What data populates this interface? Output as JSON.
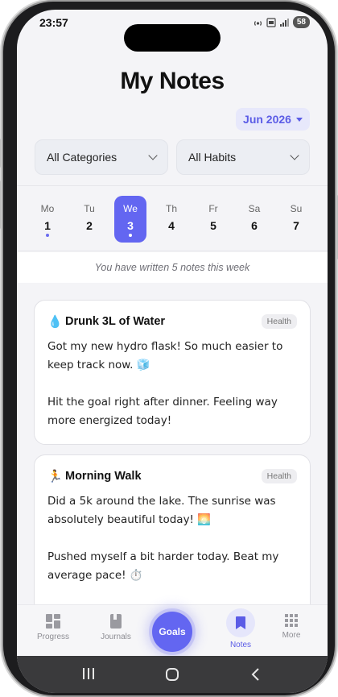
{
  "status_bar": {
    "time": "23:57",
    "battery": "58"
  },
  "header": {
    "title": "My Notes",
    "month": "Jun 2026"
  },
  "filters": {
    "category": "All Categories",
    "habit": "All Habits"
  },
  "week": {
    "days": [
      {
        "name": "Mo",
        "num": "1",
        "has_note": true
      },
      {
        "name": "Tu",
        "num": "2",
        "has_note": false
      },
      {
        "name": "We",
        "num": "3",
        "has_note": true,
        "selected": true
      },
      {
        "name": "Th",
        "num": "4",
        "has_note": false
      },
      {
        "name": "Fr",
        "num": "5",
        "has_note": false
      },
      {
        "name": "Sa",
        "num": "6",
        "has_note": false
      },
      {
        "name": "Su",
        "num": "7",
        "has_note": false
      }
    ],
    "summary": "You have written 5 notes this week"
  },
  "notes": [
    {
      "emoji": "💧",
      "title": "Drunk 3L of Water",
      "tag": "Health",
      "paragraphs": [
        "Got my new hydro flask! So much easier to keep track now. 🧊",
        "Hit the goal right after dinner. Feeling way more energized today!"
      ]
    },
    {
      "emoji": "🏃",
      "title": "Morning Walk",
      "tag": "Health",
      "paragraphs": [
        "Did a 5k around the lake. The sunrise was absolutely beautiful today! 🌅",
        "Pushed myself a bit harder today. Beat my average pace! ⏱️"
      ]
    }
  ],
  "nav": {
    "progress": "Progress",
    "journals": "Journals",
    "goals": "Goals",
    "notes": "Notes",
    "more": "More"
  },
  "colors": {
    "accent": "#6366f1",
    "accent_soft": "#e7e8fb"
  }
}
